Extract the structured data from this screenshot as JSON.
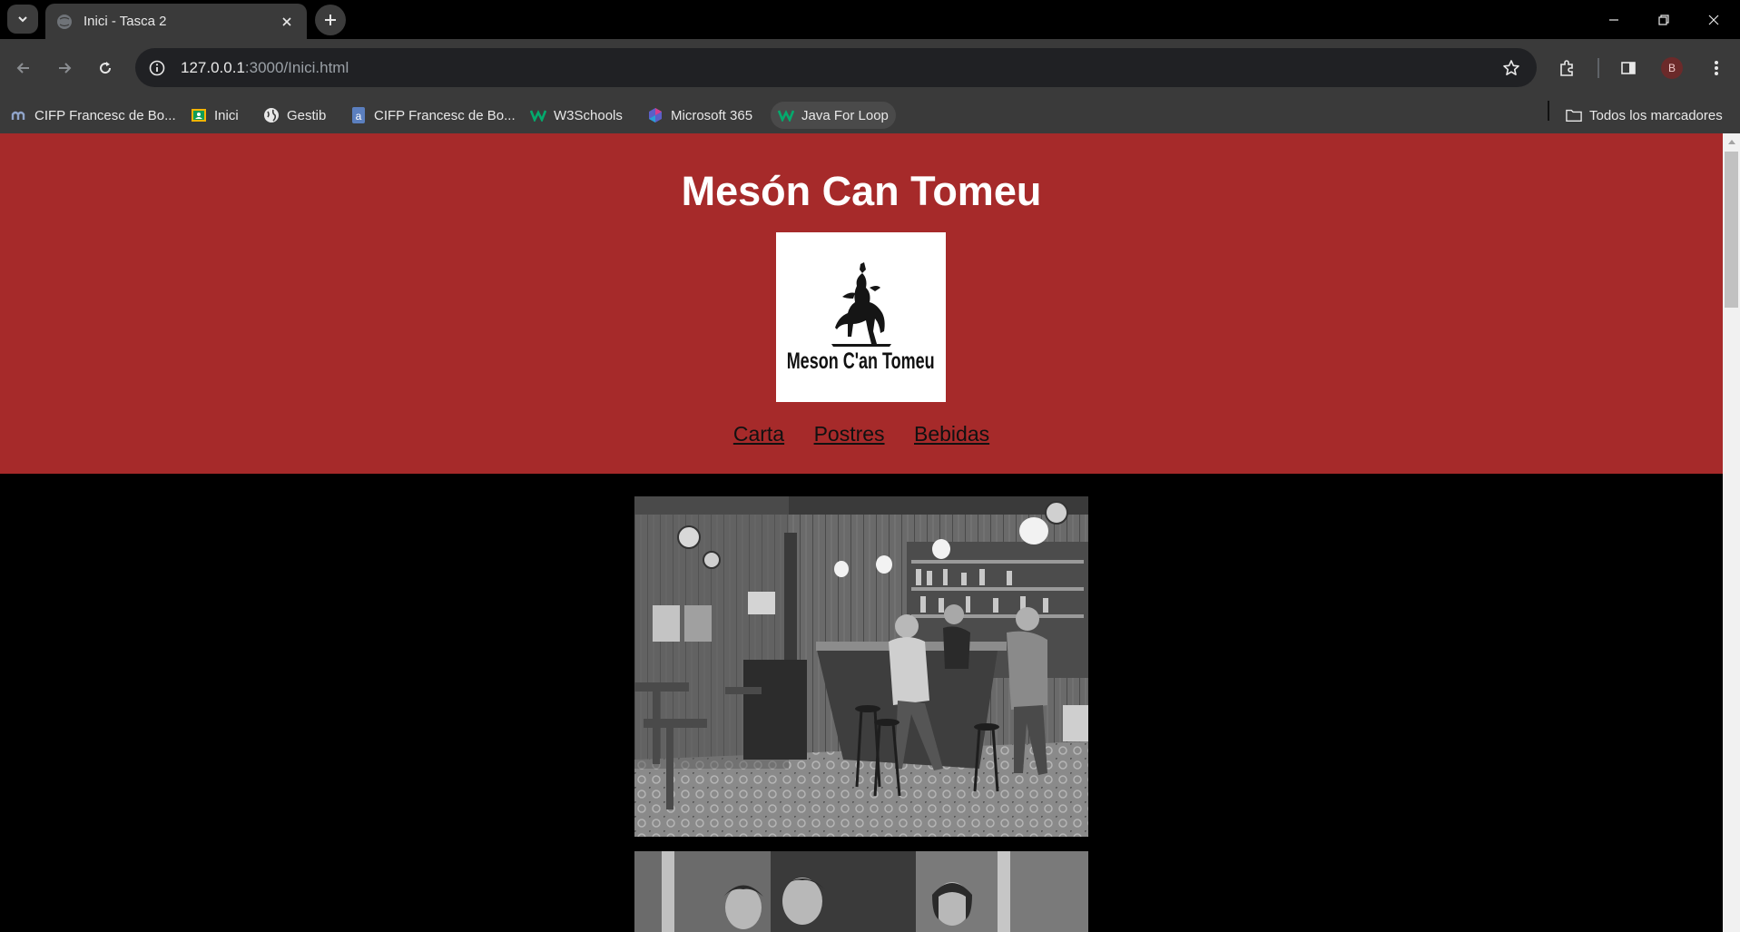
{
  "browser": {
    "tab_title": "Inici - Tasca 2",
    "url_host": "127.0.0.1",
    "url_path": ":3000/Inici.html",
    "profile_initial": "B",
    "bookmarks": [
      {
        "label": "CIFP Francesc de Bo...",
        "icon": "moodle-icon"
      },
      {
        "label": "Inici",
        "icon": "classroom-icon"
      },
      {
        "label": "Gestib",
        "icon": "globe-icon"
      },
      {
        "label": "CIFP Francesc de Bo...",
        "icon": "bookmark-site-icon"
      },
      {
        "label": "W3Schools",
        "icon": "w3schools-icon"
      },
      {
        "label": "Microsoft 365",
        "icon": "microsoft365-icon"
      },
      {
        "label": "Java For Loop",
        "icon": "w3schools-icon"
      }
    ],
    "all_bookmarks_label": "Todos los marcadores"
  },
  "page": {
    "title": "Mesón Can Tomeu",
    "logo_text": "Meson C'an Tomeu",
    "nav": [
      {
        "label": "Carta"
      },
      {
        "label": "Postres"
      },
      {
        "label": "Bebidas"
      }
    ]
  },
  "colors": {
    "header_bg": "#a62a2a",
    "page_bg": "#000000"
  }
}
